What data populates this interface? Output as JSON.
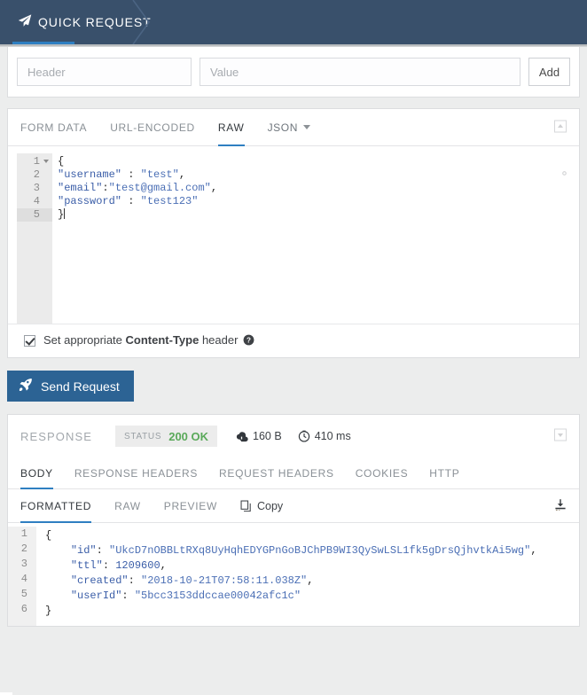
{
  "header": {
    "tab_title": "QUICK REQUEST",
    "plane_icon": "paper-plane-icon"
  },
  "headers_section": {
    "header_placeholder": "Header",
    "header_value": "",
    "value_placeholder": "Value",
    "value_value": "",
    "add_label": "Add"
  },
  "body_section": {
    "tabs": [
      {
        "label": "FORM DATA",
        "active": false
      },
      {
        "label": "URL-ENCODED",
        "active": false
      },
      {
        "label": "RAW",
        "active": true
      }
    ],
    "format_select": "JSON",
    "collapse_icon": "collapse-up-icon",
    "gear_icon": "gear-icon",
    "editor": {
      "lines": [
        {
          "num": "1",
          "foldable": true,
          "active": false,
          "tokens": [
            {
              "t": "punc",
              "v": "{"
            }
          ]
        },
        {
          "num": "2",
          "foldable": false,
          "active": false,
          "tokens": [
            {
              "t": "key",
              "v": "\"username\""
            },
            {
              "t": "punc",
              "v": " : "
            },
            {
              "t": "str",
              "v": "\"test\""
            },
            {
              "t": "punc",
              "v": ","
            }
          ]
        },
        {
          "num": "3",
          "foldable": false,
          "active": false,
          "tokens": [
            {
              "t": "key",
              "v": "\"email\""
            },
            {
              "t": "punc",
              "v": ":"
            },
            {
              "t": "str",
              "v": "\"test@gmail.com\""
            },
            {
              "t": "punc",
              "v": ","
            }
          ]
        },
        {
          "num": "4",
          "foldable": false,
          "active": false,
          "tokens": [
            {
              "t": "key",
              "v": "\"password\""
            },
            {
              "t": "punc",
              "v": " : "
            },
            {
              "t": "str",
              "v": "\"test123\""
            }
          ]
        },
        {
          "num": "5",
          "foldable": false,
          "active": true,
          "tokens": [
            {
              "t": "punc",
              "v": "}"
            }
          ]
        }
      ]
    },
    "content_type": {
      "checked": true,
      "text_before": "Set appropriate ",
      "text_bold": "Content-Type",
      "text_after": " header",
      "help_icon": "help-circle-icon"
    }
  },
  "send": {
    "label": "Send Request",
    "icon": "rocket-icon"
  },
  "response": {
    "title": "RESPONSE",
    "status_label": "STATUS",
    "status_code": "200 OK",
    "size": "160 B",
    "time": "410 ms",
    "size_icon": "cloud-download-icon",
    "time_icon": "clock-icon",
    "collapse_icon": "collapse-down-icon",
    "download_icon": "download-icon",
    "tabs": [
      {
        "label": "BODY",
        "active": true
      },
      {
        "label": "RESPONSE HEADERS",
        "active": false
      },
      {
        "label": "REQUEST HEADERS",
        "active": false
      },
      {
        "label": "COOKIES",
        "active": false
      },
      {
        "label": "HTTP",
        "active": false
      }
    ],
    "view_tabs": [
      {
        "label": "FORMATTED",
        "active": true
      },
      {
        "label": "RAW",
        "active": false
      },
      {
        "label": "PREVIEW",
        "active": false
      }
    ],
    "copy_label": "Copy",
    "copy_icon": "copy-icon",
    "editor": {
      "lines": [
        {
          "num": "1",
          "tokens": [
            {
              "t": "punc",
              "v": "{"
            }
          ]
        },
        {
          "num": "2",
          "tokens": [
            {
              "t": "punc",
              "v": "    "
            },
            {
              "t": "key",
              "v": "\"id\""
            },
            {
              "t": "punc",
              "v": ": "
            },
            {
              "t": "str",
              "v": "\"UkcD7nOBBLtRXq8UyHqhEDYGPnGoBJChPB9WI3QySwLSL1fk5gDrsQjhvtkAi5wg\""
            },
            {
              "t": "punc",
              "v": ","
            }
          ]
        },
        {
          "num": "3",
          "tokens": [
            {
              "t": "punc",
              "v": "    "
            },
            {
              "t": "key",
              "v": "\"ttl\""
            },
            {
              "t": "punc",
              "v": ": "
            },
            {
              "t": "num",
              "v": "1209600"
            },
            {
              "t": "punc",
              "v": ","
            }
          ]
        },
        {
          "num": "4",
          "tokens": [
            {
              "t": "punc",
              "v": "    "
            },
            {
              "t": "key",
              "v": "\"created\""
            },
            {
              "t": "punc",
              "v": ": "
            },
            {
              "t": "str",
              "v": "\"2018-10-21T07:58:11.038Z\""
            },
            {
              "t": "punc",
              "v": ","
            }
          ]
        },
        {
          "num": "5",
          "tokens": [
            {
              "t": "punc",
              "v": "    "
            },
            {
              "t": "key",
              "v": "\"userId\""
            },
            {
              "t": "punc",
              "v": ": "
            },
            {
              "t": "str",
              "v": "\"5bcc3153ddccae00042afc1c\""
            }
          ]
        },
        {
          "num": "6",
          "tokens": [
            {
              "t": "punc",
              "v": "}"
            }
          ]
        }
      ]
    }
  },
  "colors": {
    "header_bg": "#39506b",
    "accent_blue": "#2f7fc1",
    "send_blue": "#2c6394",
    "status_green": "#5aa95a",
    "page_bg": "#eceded"
  }
}
